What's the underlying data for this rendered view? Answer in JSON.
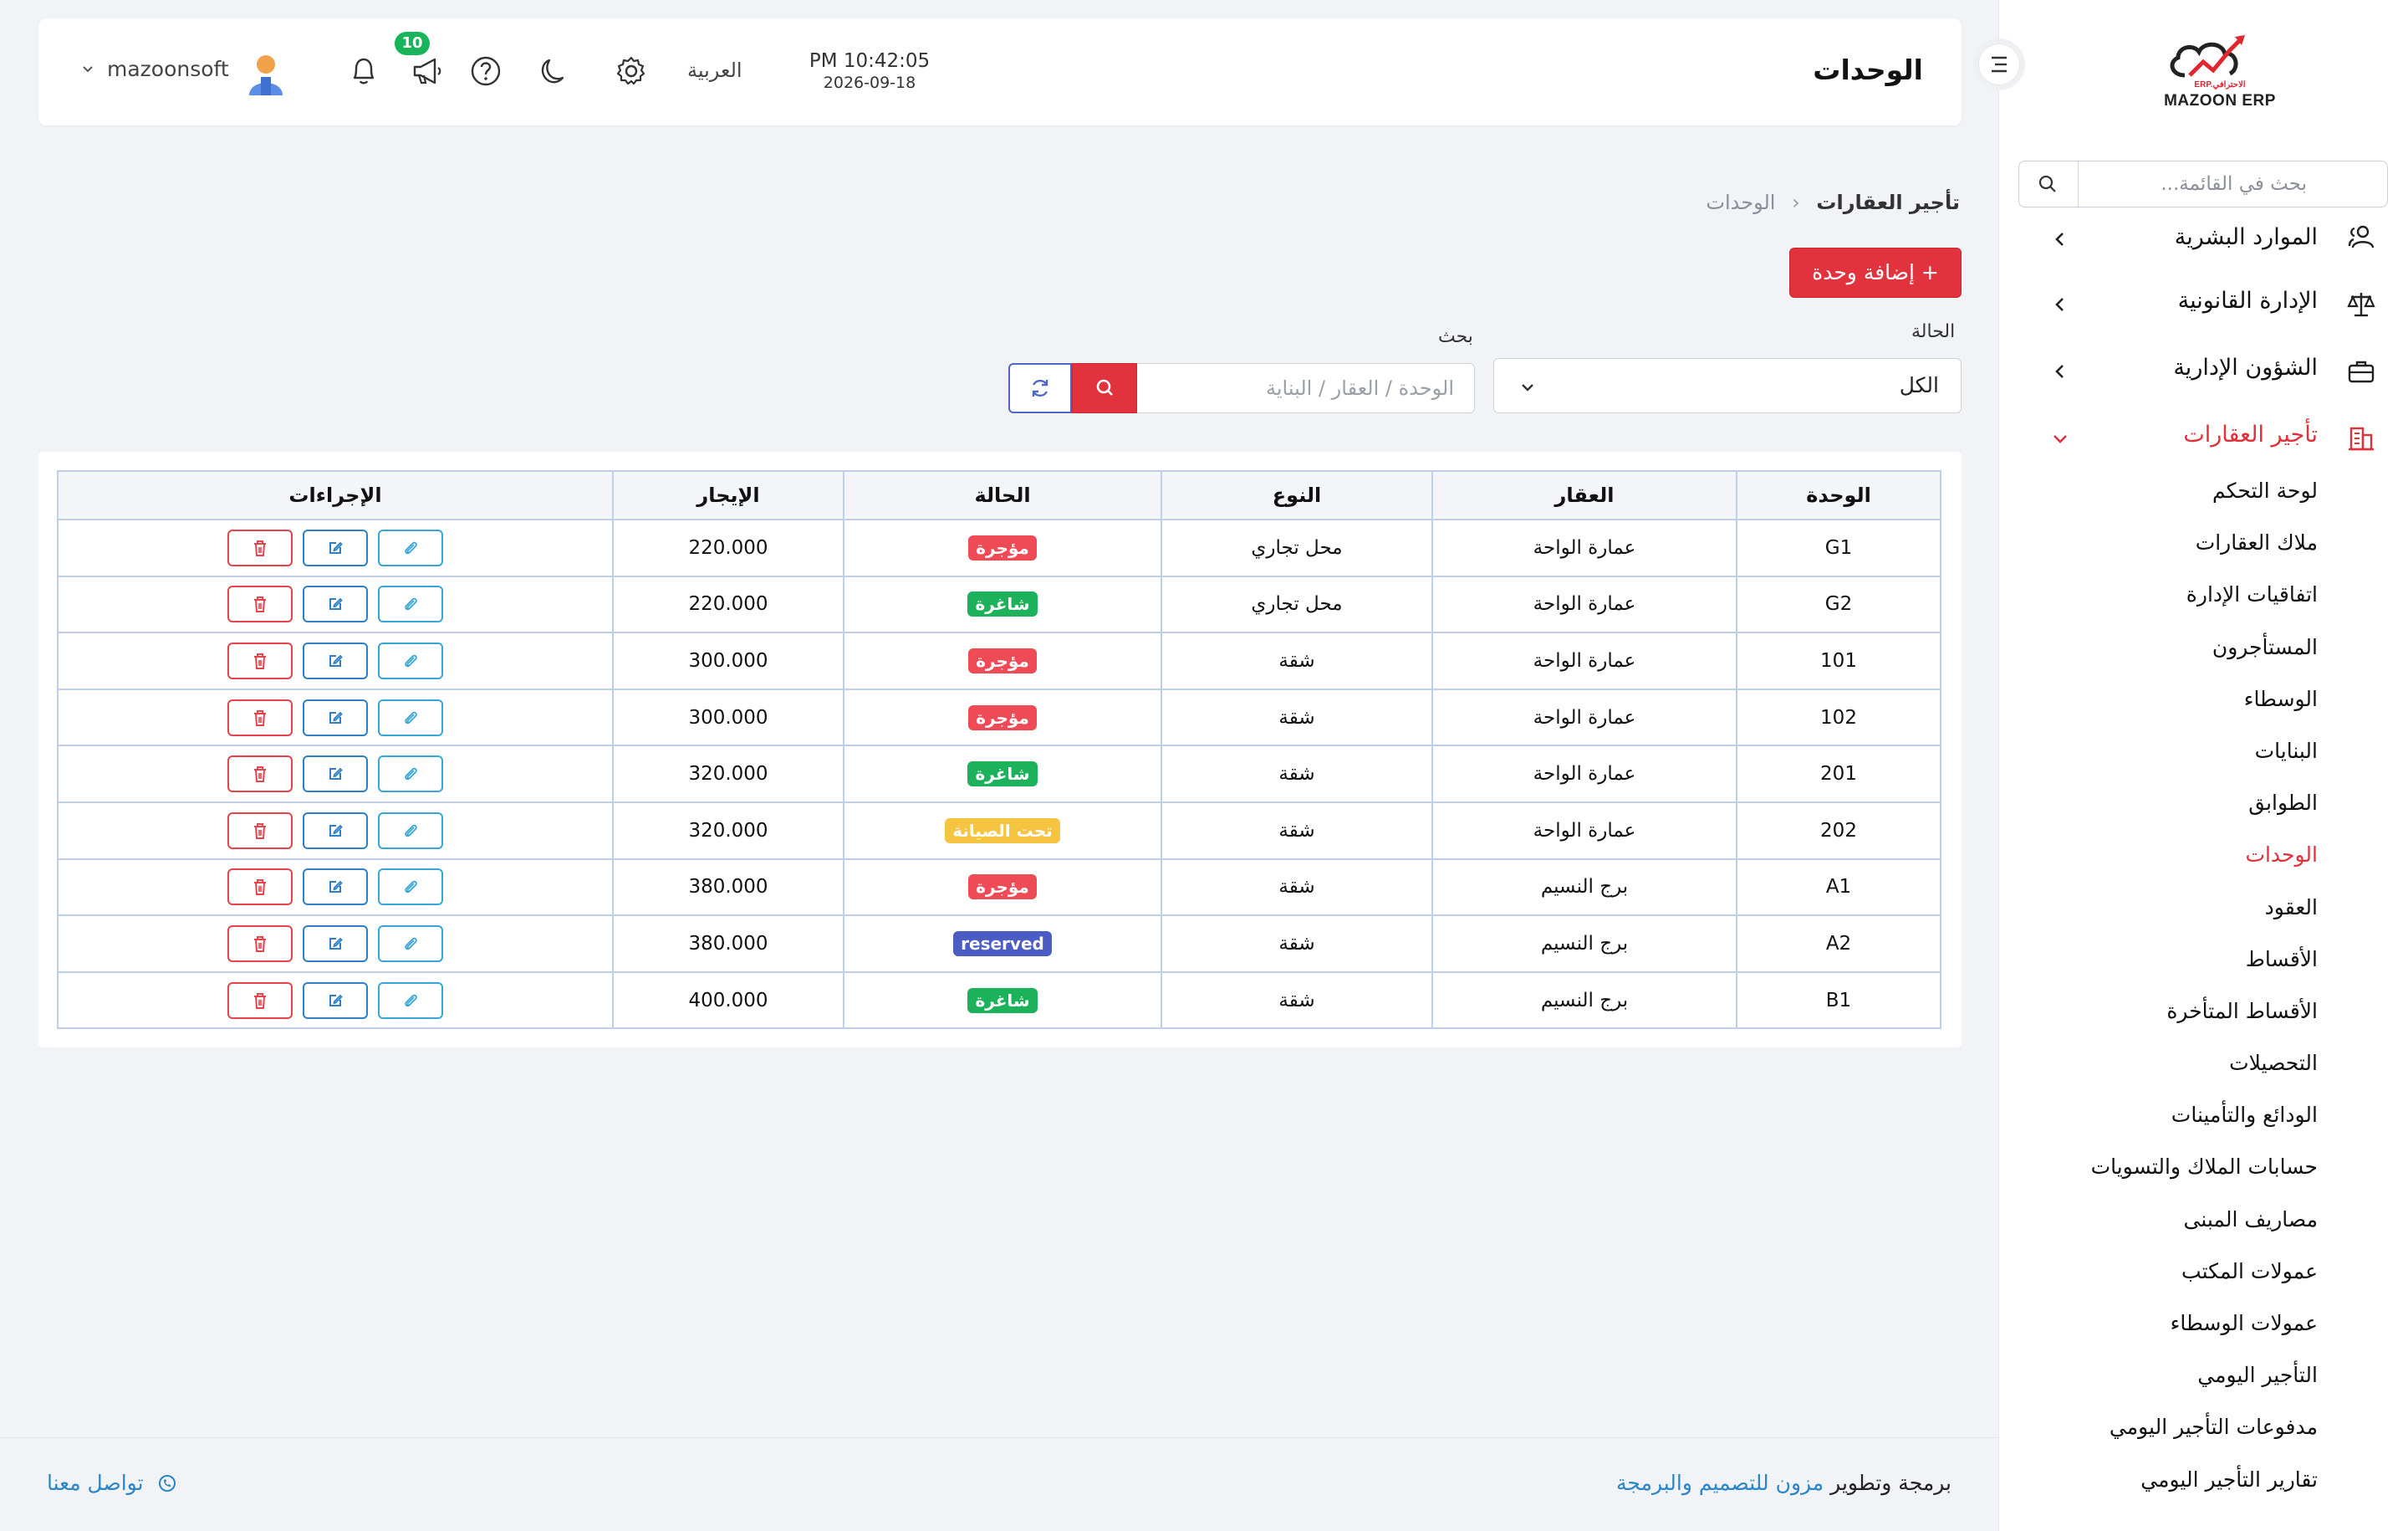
{
  "app": {
    "logo_text": "MAZOON ERP",
    "logo_subtext": "ERP.الاحترافي",
    "page_title": "الوحدات",
    "accent_color": "#e2323d"
  },
  "header": {
    "time": "PM 10:42:05",
    "date": "2026-09-18",
    "language": "العربية",
    "notification_count": "10",
    "username": "mazoonsoft"
  },
  "sidebar": {
    "search_placeholder": "بحث في القائمة...",
    "menu": [
      {
        "label": "الموارد البشرية",
        "icon": "users-icon"
      },
      {
        "label": "الإدارة القانونية",
        "icon": "scale-icon"
      },
      {
        "label": "الشؤون الإدارية",
        "icon": "briefcase-icon"
      },
      {
        "label": "تأجير العقارات",
        "icon": "buildings-icon",
        "active": true
      }
    ],
    "submenu": [
      "لوحة التحكم",
      "ملاك العقارات",
      "اتفاقيات الإدارة",
      "المستأجرون",
      "الوسطاء",
      "البنايات",
      "الطوابق",
      "الوحدات",
      "العقود",
      "الأقساط",
      "الأقساط المتأخرة",
      "التحصيلات",
      "الودائع والتأمينات",
      "حسابات الملاك والتسويات",
      "مصاريف المبنى",
      "عمولات المكتب",
      "عمولات الوسطاء",
      "التأجير اليومي",
      "مدفوعات التأجير اليومي",
      "تقارير التأجير اليومي"
    ],
    "active_submenu": "الوحدات"
  },
  "breadcrumb": {
    "parent": "تأجير العقارات",
    "current": "الوحدات"
  },
  "toolbar": {
    "add_label": "+ إضافة وحدة"
  },
  "filters": {
    "status_label": "الحالة",
    "status_value": "الكل",
    "search_label": "بحث",
    "search_placeholder": "الوحدة / العقار / البناية"
  },
  "table": {
    "headers": {
      "unit": "الوحدة",
      "property": "العقار",
      "type": "النوع",
      "status": "الحالة",
      "rent": "الإيجار",
      "actions": "الإجراءات"
    },
    "status_colors": {
      "مؤجرة": "#ef4b57",
      "شاغرة": "#1cb25c",
      "تحت الصيانة": "#f5c542",
      "reserved": "#4b5cc4"
    },
    "rows": [
      {
        "unit": "G1",
        "property": "عمارة الواحة",
        "type": "محل تجاري",
        "status": "مؤجرة",
        "rent": "220.000"
      },
      {
        "unit": "G2",
        "property": "عمارة الواحة",
        "type": "محل تجاري",
        "status": "شاغرة",
        "rent": "220.000"
      },
      {
        "unit": "101",
        "property": "عمارة الواحة",
        "type": "شقة",
        "status": "مؤجرة",
        "rent": "300.000"
      },
      {
        "unit": "102",
        "property": "عمارة الواحة",
        "type": "شقة",
        "status": "مؤجرة",
        "rent": "300.000"
      },
      {
        "unit": "201",
        "property": "عمارة الواحة",
        "type": "شقة",
        "status": "شاغرة",
        "rent": "320.000"
      },
      {
        "unit": "202",
        "property": "عمارة الواحة",
        "type": "شقة",
        "status": "تحت الصيانة",
        "rent": "320.000"
      },
      {
        "unit": "A1",
        "property": "برج النسيم",
        "type": "شقة",
        "status": "مؤجرة",
        "rent": "380.000"
      },
      {
        "unit": "A2",
        "property": "برج النسيم",
        "type": "شقة",
        "status": "reserved",
        "rent": "380.000"
      },
      {
        "unit": "B1",
        "property": "برج النسيم",
        "type": "شقة",
        "status": "شاغرة",
        "rent": "400.000"
      }
    ]
  },
  "footer": {
    "contact_label": "تواصل معنا",
    "credit_prefix": "برمجة وتطوير",
    "credit_company": "مزون للتصميم والبرمجة"
  }
}
